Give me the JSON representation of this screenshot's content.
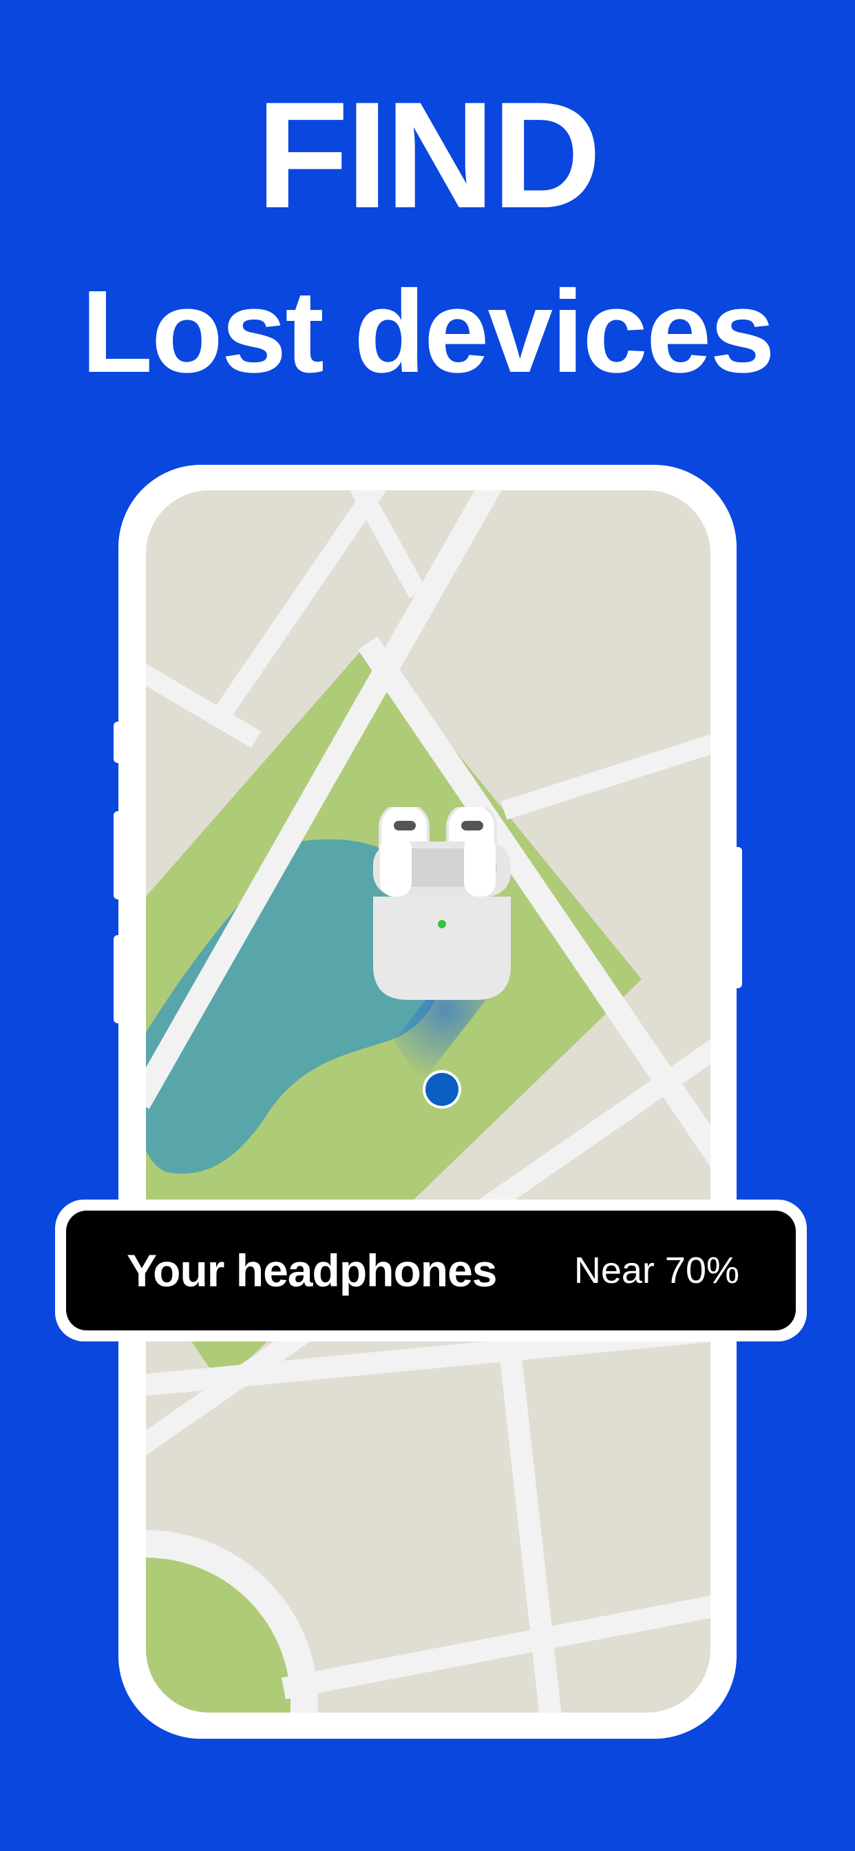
{
  "header": {
    "title": "FIND",
    "subtitle": "Lost devices"
  },
  "device_card": {
    "name": "Your headphones",
    "proximity": "Near 70%"
  },
  "icons": {
    "device": "earbuds-case-icon",
    "location": "location-dot-icon"
  },
  "colors": {
    "background": "#0a47df",
    "banner_background": "#000000",
    "map_land": "#e0ddd3",
    "map_park": "#aecb78",
    "map_water": "#58a5aa",
    "map_road": "#f2f2f2",
    "location_dot": "#0a5ec4"
  }
}
